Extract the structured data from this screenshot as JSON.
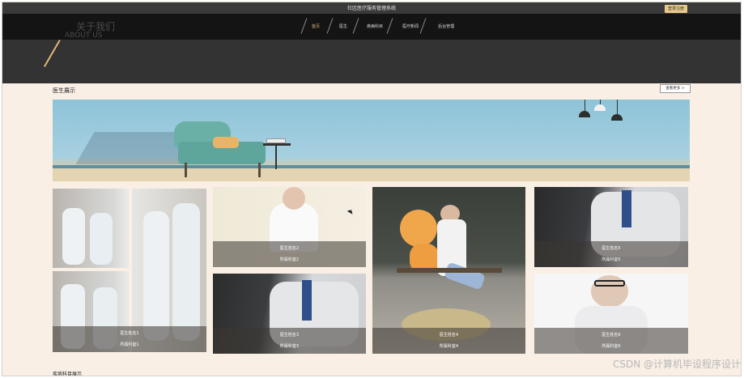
{
  "topbar": {
    "title": "社区医疗服务管理系统",
    "login_label": "登录注册"
  },
  "nav": {
    "items": [
      {
        "label": "首页",
        "active": true
      },
      {
        "label": "医生",
        "active": false
      },
      {
        "label": "疾病科目",
        "active": false
      },
      {
        "label": "医疗新闻",
        "active": false
      },
      {
        "label": "后台管理",
        "active": false
      }
    ]
  },
  "hero": {
    "about_cn": "关于我们",
    "about_en": "ABOUT US"
  },
  "doctors": {
    "title": "医生展示",
    "more_label": "查看更多 >",
    "cards": [
      {
        "name": "医生姓名1",
        "dept": "所属科室1"
      },
      {
        "name": "医生姓名2",
        "dept": "所属科室2"
      },
      {
        "name": "医生姓名3",
        "dept": "所属科室3"
      },
      {
        "name": "医生姓名4",
        "dept": "所属科室4"
      },
      {
        "name": "医生姓名5",
        "dept": "所属科室5"
      },
      {
        "name": "医生姓名6",
        "dept": "所属科室6"
      }
    ]
  },
  "disease_section": {
    "title": "疾病科目展示"
  },
  "watermark": "CSDN @计算机毕设程序设计",
  "colors": {
    "accent": "#e0b77a",
    "nav_bg": "#141414",
    "page_bg": "#f9efe5"
  }
}
